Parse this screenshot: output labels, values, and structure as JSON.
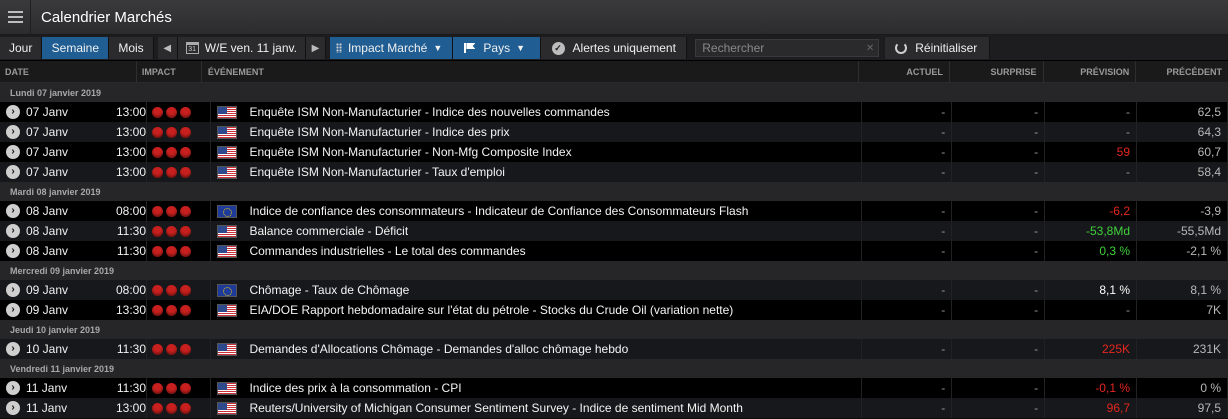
{
  "app": {
    "title": "Calendrier Marchés"
  },
  "toolbar": {
    "period_tabs": [
      "Jour",
      "Semaine",
      "Mois"
    ],
    "date_label": "W/E ven. 11 janv.",
    "calendar_icon_text": "31",
    "impact_label": "Impact Marché",
    "country_label": "Pays",
    "alerts_label": "Alertes uniquement",
    "search_placeholder": "Rechercher",
    "reset_label": "Réinitialiser"
  },
  "columns": {
    "date": "DATE",
    "impact": "IMPACT",
    "event": "ÉVÉNEMENT",
    "actual": "ACTUEL",
    "surprise": "SURPRISE",
    "forecast": "PRÉVISION",
    "previous": "PRÉCÉDENT"
  },
  "colors": {
    "accent": "#1f5d93",
    "impact_high": "#c8201e",
    "negative": "#e52620",
    "positive": "#3fd13a"
  },
  "groups": [
    {
      "label": "Lundi 07 janvier 2019",
      "rows": [
        {
          "day": "07 Janv",
          "time": "13:00",
          "flag": "us",
          "event": "Enquête ISM Non-Manufacturier - Indice des nouvelles commandes",
          "actual": "-",
          "surprise": "-",
          "forecast": "-",
          "forecast_style": "dash",
          "previous": "62,5"
        },
        {
          "day": "07 Janv",
          "time": "13:00",
          "flag": "us",
          "event": "Enquête ISM Non-Manufacturier - Indice des prix",
          "actual": "-",
          "surprise": "-",
          "forecast": "-",
          "forecast_style": "dash",
          "previous": "64,3"
        },
        {
          "day": "07 Janv",
          "time": "13:00",
          "flag": "us",
          "event": "Enquête ISM Non-Manufacturier - Non-Mfg Composite Index",
          "actual": "-",
          "surprise": "-",
          "forecast": "59",
          "forecast_style": "neg",
          "previous": "60,7"
        },
        {
          "day": "07 Janv",
          "time": "13:00",
          "flag": "us",
          "event": "Enquête ISM Non-Manufacturier - Taux d'emploi",
          "actual": "-",
          "surprise": "-",
          "forecast": "-",
          "forecast_style": "dash",
          "previous": "58,4"
        }
      ]
    },
    {
      "label": "Mardi 08 janvier 2019",
      "rows": [
        {
          "day": "08 Janv",
          "time": "08:00",
          "flag": "eu",
          "event": "Indice de confiance des consommateurs - Indicateur de Confiance des Consommateurs Flash",
          "actual": "-",
          "surprise": "-",
          "forecast": "-6,2",
          "forecast_style": "neg",
          "previous": "-3,9"
        },
        {
          "day": "08 Janv",
          "time": "11:30",
          "flag": "us",
          "event": "Balance commerciale - Déficit",
          "actual": "-",
          "surprise": "-",
          "forecast": "-53,8Md",
          "forecast_style": "pos",
          "previous": "-55,5Md"
        },
        {
          "day": "08 Janv",
          "time": "11:30",
          "flag": "us",
          "event": "Commandes industrielles - Le total des commandes",
          "actual": "-",
          "surprise": "-",
          "forecast": "0,3 %",
          "forecast_style": "pos",
          "previous": "-2,1 %"
        }
      ]
    },
    {
      "label": "Mercredi 09 janvier 2019",
      "rows": [
        {
          "day": "09 Janv",
          "time": "08:00",
          "flag": "eu",
          "event": "Chômage - Taux de Chômage",
          "actual": "-",
          "surprise": "-",
          "forecast": "8,1 %",
          "forecast_style": "white",
          "previous": "8,1 %"
        },
        {
          "day": "09 Janv",
          "time": "13:30",
          "flag": "us",
          "event": "EIA/DOE Rapport hebdomadaire sur l'état du pétrole - Stocks du Crude Oil (variation nette)",
          "actual": "-",
          "surprise": "-",
          "forecast": "-",
          "forecast_style": "dash",
          "previous": "7K"
        }
      ]
    },
    {
      "label": "Jeudi 10 janvier 2019",
      "rows": [
        {
          "day": "10 Janv",
          "time": "11:30",
          "flag": "us",
          "event": "Demandes d'Allocations Chômage - Demandes d'alloc chômage hebdo",
          "actual": "-",
          "surprise": "-",
          "forecast": "225K",
          "forecast_style": "neg",
          "previous": "231K"
        }
      ]
    },
    {
      "label": "Vendredi 11 janvier 2019",
      "rows": [
        {
          "day": "11 Janv",
          "time": "11:30",
          "flag": "us",
          "event": "Indice des prix à la consommation - CPI",
          "actual": "-",
          "surprise": "-",
          "forecast": "-0,1 %",
          "forecast_style": "neg",
          "previous": "0 %"
        },
        {
          "day": "11 Janv",
          "time": "13:00",
          "flag": "us",
          "event": "Reuters/University of Michigan Consumer Sentiment Survey - Indice de sentiment Mid Month",
          "actual": "-",
          "surprise": "-",
          "forecast": "96,7",
          "forecast_style": "neg",
          "previous": "97,5"
        }
      ]
    }
  ]
}
